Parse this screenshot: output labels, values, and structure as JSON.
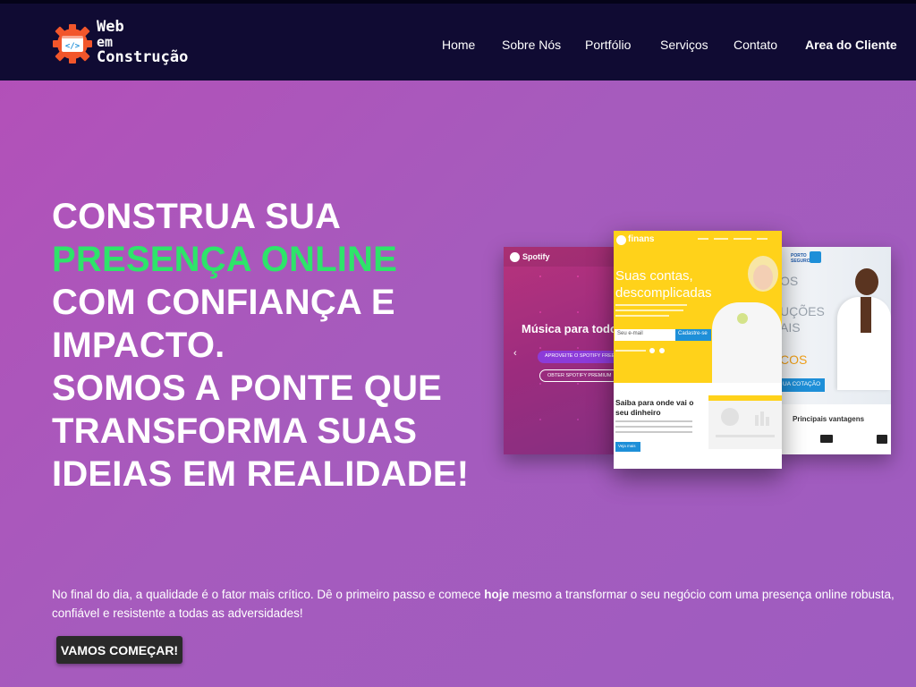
{
  "brand": {
    "line1": "Web",
    "line2": "em",
    "line3": "Construção",
    "icon": "code-gear-icon",
    "icon_color": "#f2562b",
    "icon_glyph": "</>"
  },
  "nav": {
    "items": [
      {
        "label": "Home"
      },
      {
        "label": "Sobre Nós"
      },
      {
        "label": "Portfólio"
      },
      {
        "label": "Serviços"
      },
      {
        "label": "Contato"
      },
      {
        "label": "Area do Cliente"
      }
    ]
  },
  "hero": {
    "headline": {
      "line1": "CONSTRUA SUA",
      "line2": "PRESENÇA ONLINE",
      "line3": "COM CONFIANÇA E",
      "line4": "IMPACTO.",
      "line5": "SOMOS A PONTE QUE",
      "line6": "TRANSFORMA SUAS",
      "line7": "IDEIAS EM REALIDADE!"
    },
    "intro_part1": "No final do dia, a qualidade é o fator mais crítico. Dê o primeiro passo e comece ",
    "intro_bold": "hoje",
    "intro_part2": " mesmo a transformar o seu negócio com uma presença online robusta, confiável e resistente a todas as adversidades!",
    "cta": "VAMOS COMEÇAR!"
  },
  "mockups": {
    "spotify": {
      "brand": "Spotify",
      "headline": "Música para todos",
      "btn1": "APROVEITE O SPOTIFY FREE",
      "btn2": "OBTER SPOTIFY PREMIUM"
    },
    "finans": {
      "brand": "finans",
      "headline1": "Suas contas,",
      "headline2": "descomplicadas",
      "email_placeholder": "Seu e-mail",
      "signup": "Cadastre-se",
      "section_title1": "Saiba para onde vai o",
      "section_title2": "seu dinheiro",
      "section_button": "Veja mais"
    },
    "porto": {
      "brand": "PORTO SEGURO",
      "frag1": "OS",
      "frag2": "UÇÕES",
      "frag3": "AIS",
      "frag4": "COS",
      "cta_fragment": "UA COTAÇÃO",
      "subtitle": "Principais vantagens"
    }
  },
  "colors": {
    "navbar": "#100b33",
    "accent_green": "#2ee46a",
    "cta_bg": "#2a2a2a",
    "finans_yellow": "#ffd21a",
    "porto_blue": "#1e8fd8"
  }
}
